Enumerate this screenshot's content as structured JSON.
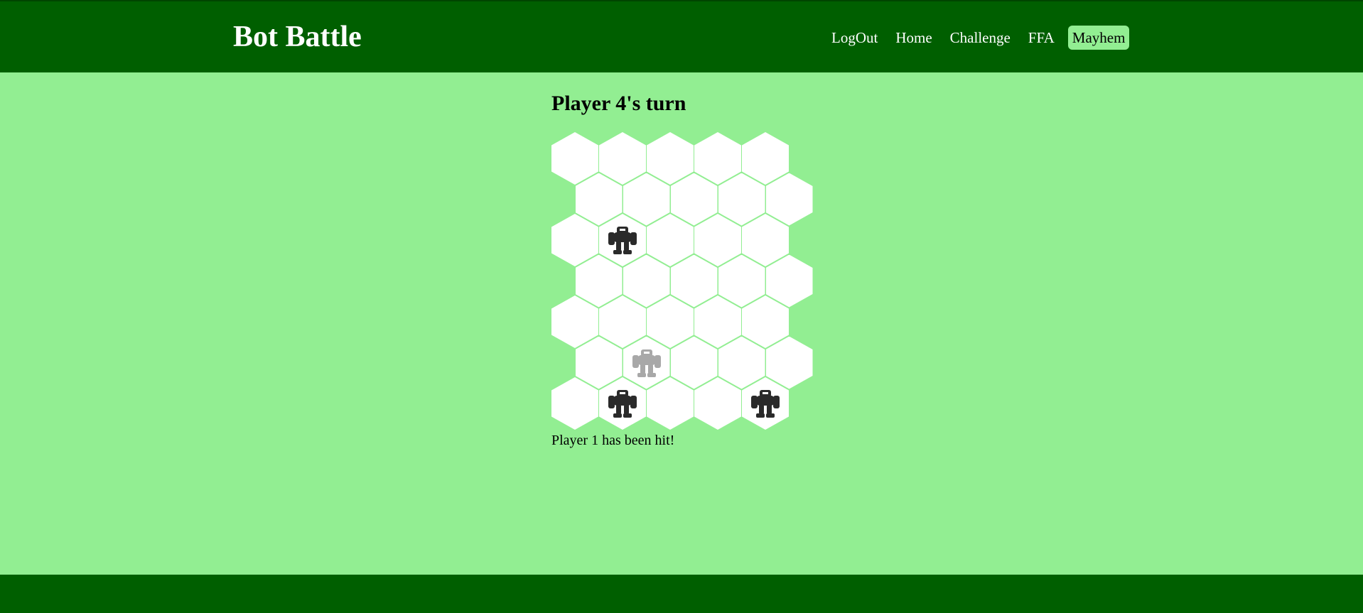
{
  "app": {
    "title": "Bot Battle"
  },
  "nav": {
    "items": [
      {
        "label": "LogOut",
        "active": false
      },
      {
        "label": "Home",
        "active": false
      },
      {
        "label": "Challenge",
        "active": false
      },
      {
        "label": "FFA",
        "active": false
      },
      {
        "label": "Mayhem",
        "active": true
      }
    ]
  },
  "game": {
    "turn_text": "Player 4's turn",
    "message": "Player 1 has been hit!",
    "board": {
      "rows": 7,
      "cols": 5,
      "robots": [
        {
          "row": 2,
          "col": 1,
          "icon": "robot-icon",
          "style": "dark"
        },
        {
          "row": 5,
          "col": 1,
          "icon": "robot-icon",
          "style": "hit"
        },
        {
          "row": 6,
          "col": 1,
          "icon": "robot-icon",
          "style": "dark"
        },
        {
          "row": 6,
          "col": 4,
          "icon": "robot-icon",
          "style": "dark"
        }
      ]
    }
  },
  "colors": {
    "header_bg": "#005f00",
    "page_bg": "#92ee92",
    "hex_fill": "#ffffff",
    "active_nav_bg": "#92ee92"
  }
}
